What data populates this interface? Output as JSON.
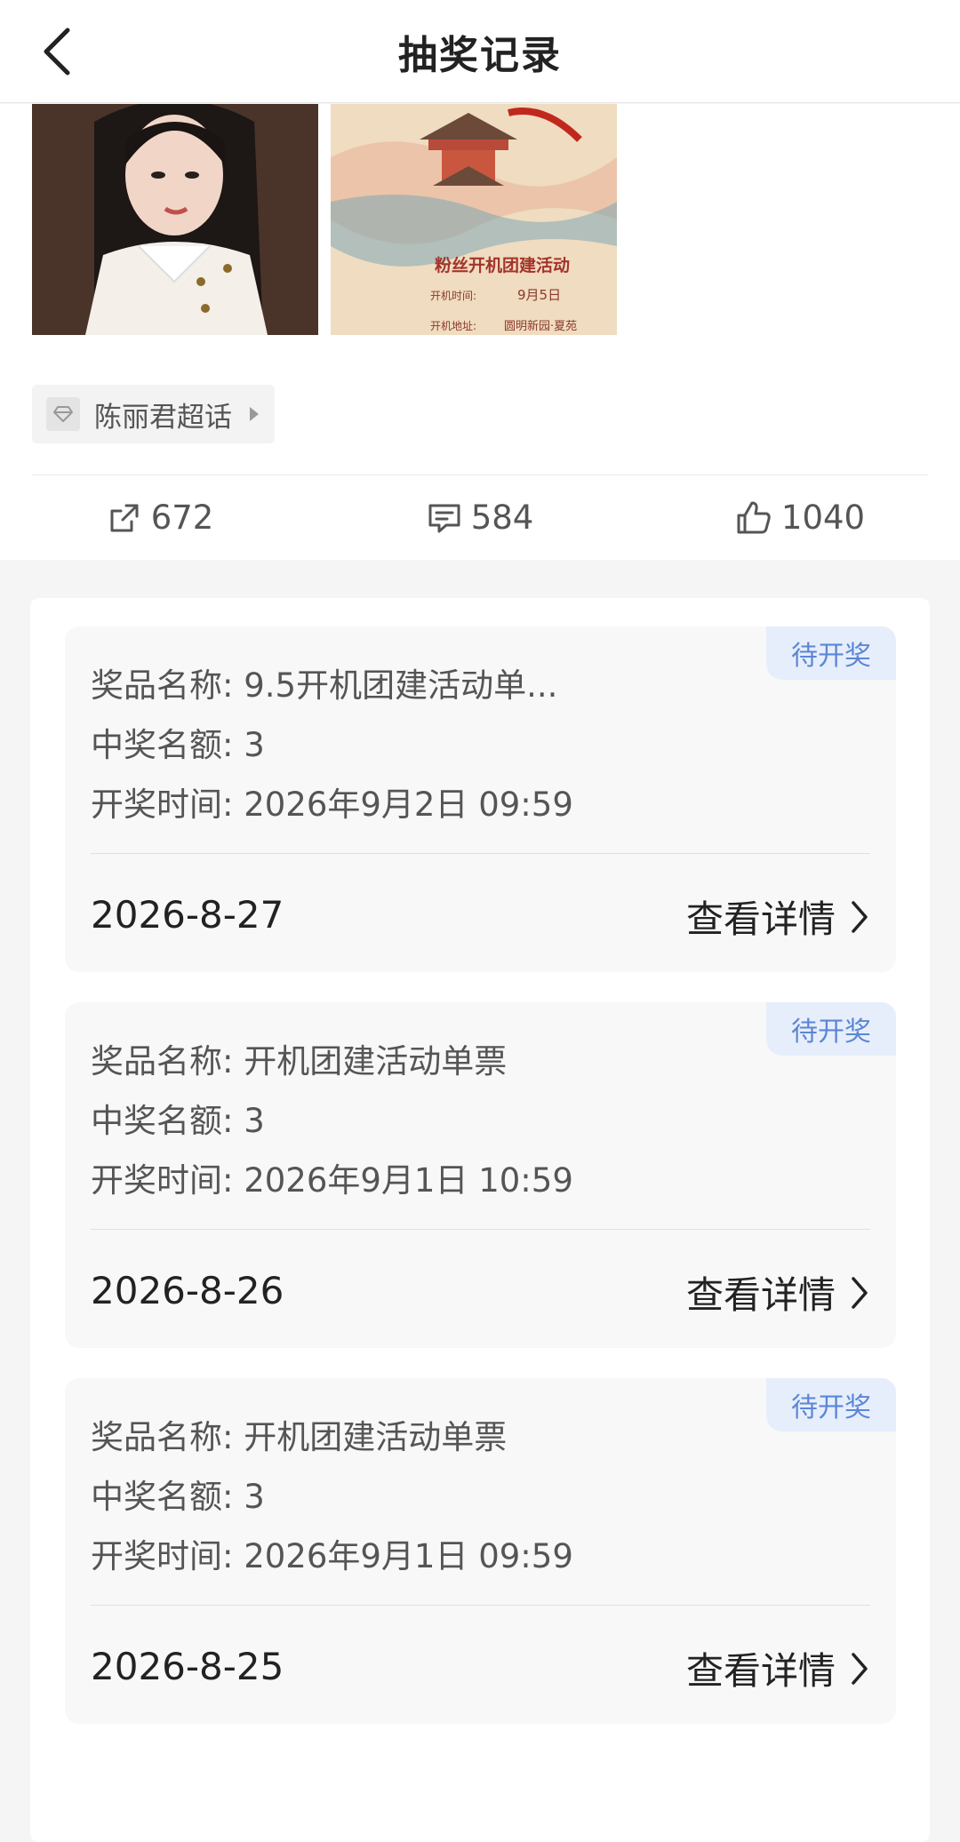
{
  "nav": {
    "title": "抽奖记录"
  },
  "post": {
    "images": [
      "portrait-photo",
      "fan-event-poster"
    ],
    "poster_text": {
      "headline": "粉丝开机团建活动",
      "time_label": "开机时间:",
      "time_value": "9月5日",
      "place_label": "开机地址:",
      "place_value": "圆明新园·夏苑"
    },
    "topic": {
      "label": "陈丽君超话",
      "icon": "diamond-icon"
    },
    "actions": {
      "share": {
        "icon": "share-icon",
        "count": "672"
      },
      "comment": {
        "icon": "comment-icon",
        "count": "584"
      },
      "like": {
        "icon": "thumbs-up-icon",
        "count": "1040"
      }
    }
  },
  "records": [
    {
      "status": "待开奖",
      "prize": "奖品名称:  9.5开机团建活动单...",
      "quota": "中奖名额: 3",
      "draw_time": "开奖时间: 2026年9月2日 09:59",
      "date": "2026-8-27",
      "detail_label": "查看详情"
    },
    {
      "status": "待开奖",
      "prize": "奖品名称:  开机团建活动单票",
      "quota": "中奖名额: 3",
      "draw_time": "开奖时间: 2026年9月1日 10:59",
      "date": "2026-8-26",
      "detail_label": "查看详情"
    },
    {
      "status": "待开奖",
      "prize": "奖品名称:  开机团建活动单票",
      "quota": "中奖名额: 3",
      "draw_time": "开奖时间: 2026年9月1日 09:59",
      "date": "2026-8-25",
      "detail_label": "查看详情"
    }
  ],
  "colors": {
    "status": "#5b86d6",
    "status_bg": "#e6eefb"
  }
}
